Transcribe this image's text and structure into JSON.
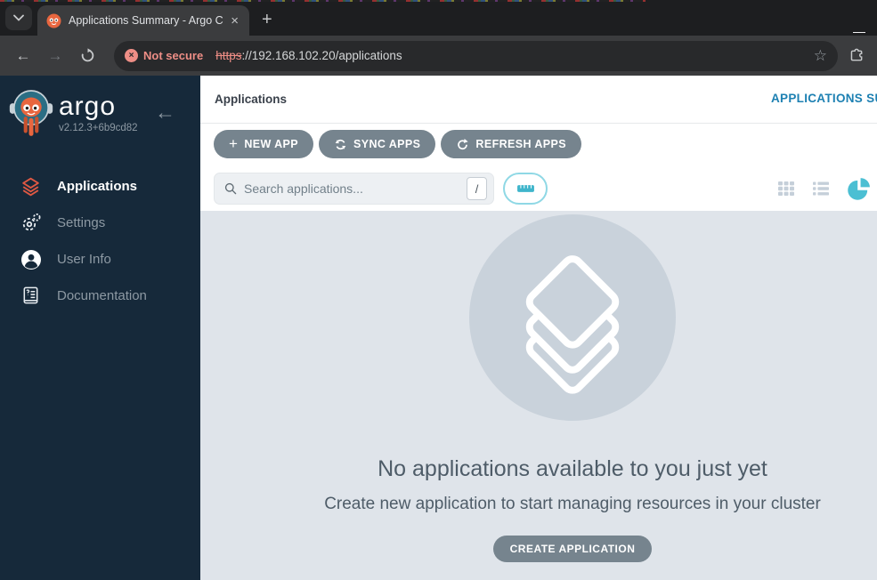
{
  "window": {
    "minimize_glyph": "—"
  },
  "browser": {
    "tab": {
      "title": "Applications Summary - Argo C",
      "close_glyph": "×"
    },
    "new_tab_glyph": "+",
    "nav": {
      "back_glyph": "←",
      "forward_glyph": "→"
    },
    "address": {
      "security_label": "Not secure",
      "security_badge_glyph": "×",
      "scheme": "https",
      "url_rest": "://192.168.102.20/applications"
    },
    "star_glyph": "☆"
  },
  "sidebar": {
    "logo_text": "argo",
    "version": "v2.12.3+6b9cd82",
    "collapse_glyph": "←",
    "items": [
      {
        "label": "Applications",
        "active": true
      },
      {
        "label": "Settings",
        "active": false
      },
      {
        "label": "User Info",
        "active": false
      },
      {
        "label": "Documentation",
        "active": false
      }
    ]
  },
  "header": {
    "breadcrumb": "Applications",
    "summary_link": "APPLICATIONS SUMMARY"
  },
  "toolbar": {
    "new_app_plus": "+",
    "new_app_label": "NEW APP",
    "sync_apps_label": "SYNC APPS",
    "refresh_apps_label": "REFRESH APPS",
    "search_placeholder": "Search applications...",
    "search_shortcut": "/"
  },
  "empty_state": {
    "title": "No applications available to you just yet",
    "subtitle": "Create new application to start managing resources in your cluster",
    "cta_label": "CREATE APPLICATION"
  },
  "colors": {
    "sidebar_bg": "#16293A",
    "accent_orange": "#DE5843",
    "teal": "#4BBFD3",
    "link_blue": "#1D80B2",
    "button_slate": "#76848E",
    "content_bg": "#DFE4EA",
    "not_secure_red": "#EE8E86"
  }
}
